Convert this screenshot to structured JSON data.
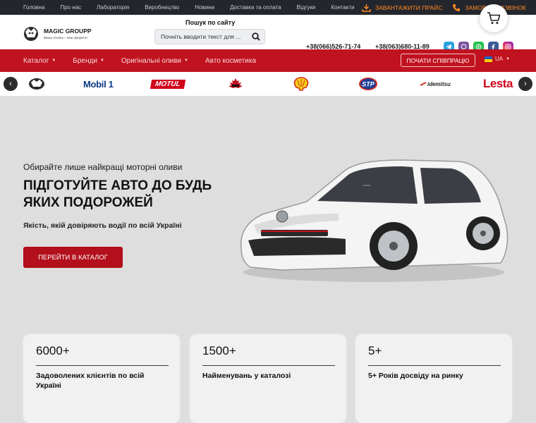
{
  "topbar": {
    "nav": [
      "Головна",
      "Про нас",
      "Лабораторія",
      "Виробництво",
      "Новини",
      "Доставка та оплата",
      "Відгуки",
      "Контакти"
    ],
    "download_price": "ЗАВАНТАЖИТИ ПРАЙС",
    "order_call": "ЗАМОВИТИ ДЗВІНОК"
  },
  "header": {
    "logo_name": "MAGIC GROUPP",
    "logo_tagline": "Ваша техніка – наш пріоритет",
    "search_title": "Пошук по сайту",
    "search_placeholder": "Почніть вводити текст для ...",
    "phone1": "+38(066)526-71-74",
    "phone2": "+38(063)680-11-89",
    "socials": [
      "telegram-icon",
      "viber-icon",
      "whatsapp-icon",
      "facebook-icon",
      "instagram-icon"
    ]
  },
  "mainnav": {
    "items": [
      "Каталог",
      "Бренди",
      "Оригінальні оливи",
      "Авто косметика"
    ],
    "coop_button": "ПОЧАТИ СПІВПРАЦЮ",
    "lang": "UA"
  },
  "brands": {
    "items": [
      "Magic Groupp",
      "Mobil 1",
      "MOTUL",
      "Mahle",
      "Shell",
      "STP",
      "idemitsu",
      "Lesta"
    ],
    "prev": "‹",
    "next": "›"
  },
  "hero": {
    "subtitle": "Обирайте лише найкращі моторні оливи",
    "title": "Підготуйте авто до будь яких подорожей",
    "description": "Якість, якій довіряють водії по всій Україні",
    "button": "ПЕРЕЙТИ В КАТАЛОГ"
  },
  "stats": [
    {
      "number": "6000+",
      "text": "Задоволених клієнтів по всій Україні"
    },
    {
      "number": "1500+",
      "text": "Найменувань у каталозі"
    },
    {
      "number": "5+",
      "text": "5+ Років досвіду на ринку"
    }
  ],
  "colors": {
    "topbar": "#24262d",
    "accent_orange": "#ff8a24",
    "brand_red": "#c1121f",
    "hero_bg": "#dedede",
    "button_red": "#b30f1c"
  }
}
